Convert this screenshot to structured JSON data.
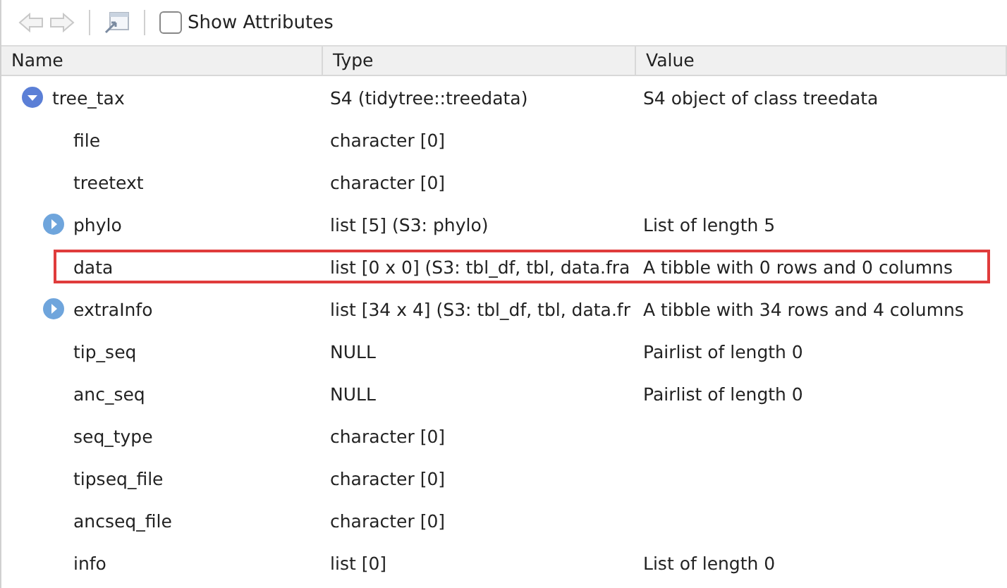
{
  "toolbar": {
    "show_attributes": {
      "label": "Show Attributes",
      "checked": false
    }
  },
  "columns": [
    "Name",
    "Type",
    "Value"
  ],
  "rows": [
    {
      "name": "tree_tax",
      "type": "S4 (tidytree::treedata)",
      "value": "S4 object of class treedata",
      "kind": "expandable",
      "expanded": true,
      "highlighted": false,
      "children": [
        {
          "name": "file",
          "type": "character [0]",
          "kind": "leaf",
          "highlighted": false
        },
        {
          "name": "treetext",
          "type": "character [0]",
          "kind": "leaf",
          "highlighted": false
        },
        {
          "name": "phylo",
          "type": "list [5] (S3: phylo)",
          "value": "List of length 5",
          "kind": "expandable",
          "expanded": false,
          "highlighted": false
        },
        {
          "name": "data",
          "type": "list [0 x 0] (S3: tbl_df, tbl, data.fra",
          "value": "A tibble with 0 rows and 0 columns",
          "kind": "leaf",
          "highlighted": true
        },
        {
          "name": "extraInfo",
          "type": "list [34 x 4] (S3: tbl_df, tbl, data.fr",
          "value": "A tibble with 34 rows and 4 columns",
          "kind": "expandable",
          "expanded": false,
          "highlighted": false
        },
        {
          "name": "tip_seq",
          "type": "NULL",
          "value": "Pairlist of length 0",
          "kind": "leaf",
          "highlighted": false
        },
        {
          "name": "anc_seq",
          "type": "NULL",
          "value": "Pairlist of length 0",
          "kind": "leaf",
          "highlighted": false
        },
        {
          "name": "seq_type",
          "type": "character [0]",
          "kind": "leaf",
          "highlighted": false
        },
        {
          "name": "tipseq_file",
          "type": "character [0]",
          "kind": "leaf",
          "highlighted": false
        },
        {
          "name": "ancseq_file",
          "type": "character [0]",
          "kind": "leaf",
          "highlighted": false
        },
        {
          "name": "info",
          "type": "list [0]",
          "value": "List of length 0",
          "kind": "leaf",
          "highlighted": false
        }
      ]
    }
  ]
}
